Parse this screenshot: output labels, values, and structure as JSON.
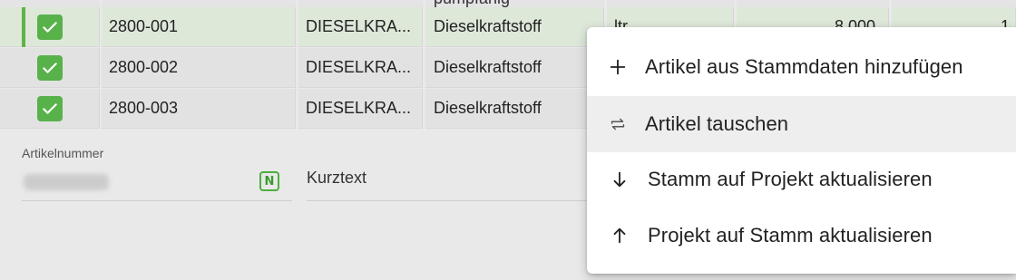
{
  "grid": {
    "partial_header_text": "pumpfähig",
    "rows": [
      {
        "checked": true,
        "number": "2800-001",
        "short": "DIESELKRA...",
        "desc": "Dieselkraftstoff",
        "unit": "ltr",
        "qty": "8.000",
        "last": "1",
        "selected": true
      },
      {
        "checked": true,
        "number": "2800-002",
        "short": "DIESELKRA...",
        "desc": "Dieselkraftstoff",
        "unit": "",
        "qty": "",
        "last": "",
        "selected": false
      },
      {
        "checked": true,
        "number": "2800-003",
        "short": "DIESELKRA...",
        "desc": "Dieselkraftstoff",
        "unit": "",
        "qty": "",
        "last": "",
        "selected": false
      }
    ]
  },
  "form": {
    "article_number_label": "Artikelnummer",
    "badge": "N",
    "short_text_label": "Kurztext"
  },
  "menu": {
    "items": [
      {
        "label": "Artikel aus Stammdaten hinzufügen",
        "icon": "plus-icon"
      },
      {
        "label": "Artikel tauschen",
        "icon": "swap-icon"
      },
      {
        "label": "Stamm auf Projekt aktualisieren",
        "icon": "arrow-down-icon"
      },
      {
        "label": "Projekt auf Stamm aktualisieren",
        "icon": "arrow-up-icon"
      }
    ],
    "hovered_index": 1
  },
  "colors": {
    "accent_green": "#58b24a",
    "selected_row": "#dde8d9",
    "menu_hover": "#eeeeee"
  }
}
